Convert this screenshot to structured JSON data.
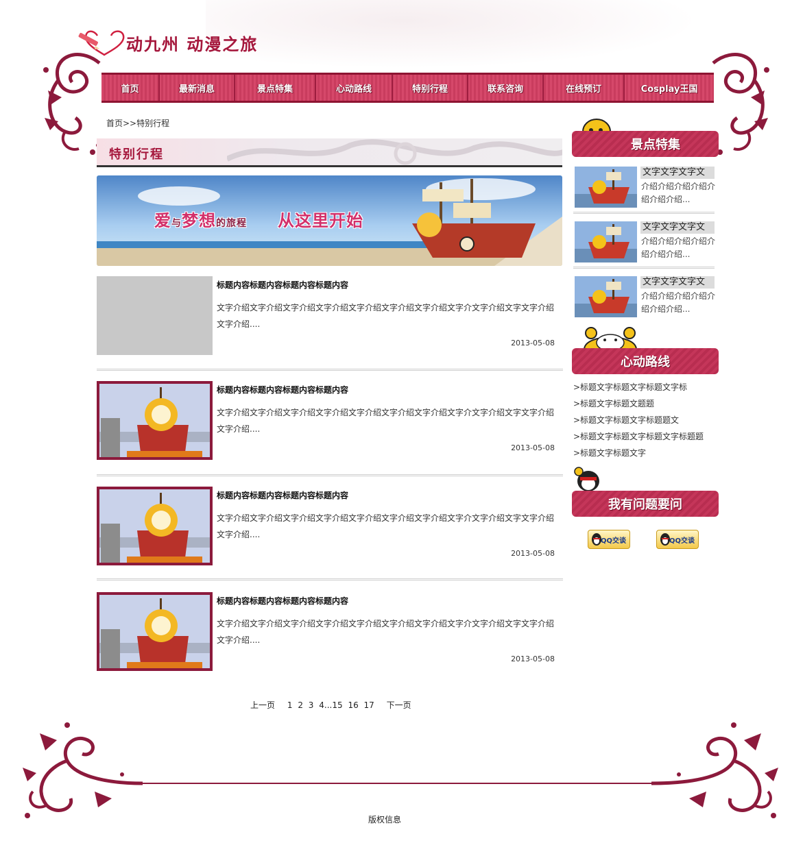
{
  "site": {
    "title": "动九州 动漫之旅"
  },
  "nav": {
    "items": [
      {
        "label": "首页"
      },
      {
        "label": "最新消息"
      },
      {
        "label": "景点特集"
      },
      {
        "label": "心动路线"
      },
      {
        "label": "特别行程"
      },
      {
        "label": "联系咨询"
      },
      {
        "label": "在线预订"
      },
      {
        "label": "Cosplay王国"
      }
    ]
  },
  "breadcrumb": {
    "text": "首页>>特别行程"
  },
  "section": {
    "title": "特别行程"
  },
  "banner": {
    "text_part1": "爱",
    "text_small1": "与",
    "text_part2": "梦想",
    "text_small2": "的旅程",
    "text_small3": "从",
    "text_part3": "这里开始"
  },
  "articles": [
    {
      "title": "标题内容标题内容标题内容标题内容",
      "body": "文字介绍文字介绍文字介绍文字介绍文字介绍文字介绍文字介绍文字介文字介绍文字文字介绍文字介绍....",
      "date": "2013-05-08",
      "thumb": "gray"
    },
    {
      "title": "标题内容标题内容标题内容标题内容",
      "body": "文字介绍文字介绍文字介绍文字介绍文字介绍文字介绍文字介绍文字介文字介绍文字文字介绍文字介绍....",
      "date": "2013-05-08",
      "thumb": "ship"
    },
    {
      "title": "标题内容标题内容标题内容标题内容",
      "body": "文字介绍文字介绍文字介绍文字介绍文字介绍文字介绍文字介绍文字介文字介绍文字文字介绍文字介绍....",
      "date": "2013-05-08",
      "thumb": "ship"
    },
    {
      "title": "标题内容标题内容标题内容标题内容",
      "body": "文字介绍文字介绍文字介绍文字介绍文字介绍文字介绍文字介绍文字介文字介绍文字文字介绍文字介绍....",
      "date": "2013-05-08",
      "thumb": "ship"
    }
  ],
  "pager": {
    "prev": "上一页",
    "pages": [
      "1",
      "2",
      "3",
      "4...15",
      "16",
      "17"
    ],
    "next": "下一页"
  },
  "sidebar": {
    "spots": {
      "title": "景点特集",
      "items": [
        {
          "title": "文字文字文字文",
          "desc": "介绍介绍介绍介绍介绍介绍介绍..."
        },
        {
          "title": "文字文字文字文",
          "desc": "介绍介绍介绍介绍介绍介绍介绍..."
        },
        {
          "title": "文字文字文字文",
          "desc": "介绍介绍介绍介绍介绍介绍介绍..."
        }
      ]
    },
    "routes": {
      "title": "心动路线",
      "items": [
        {
          "label": ">标题文字标题文字标题文字标"
        },
        {
          "label": ">标题文字标题文题题"
        },
        {
          "label": ">标题文字标题文字标题题文"
        },
        {
          "label": ">标题文字标题文字标题文字标题题"
        },
        {
          "label": ">标题文字标题文字"
        }
      ]
    },
    "ask": {
      "title": "我有问题要问",
      "qq_buttons": [
        {
          "label": "QQ交谈"
        },
        {
          "label": "QQ交谈"
        }
      ]
    }
  },
  "footer": {
    "copyright": "版权信息"
  },
  "colors": {
    "accent": "#a5173c",
    "nav": "#d6486a",
    "ornament": "#8c1a3c"
  }
}
